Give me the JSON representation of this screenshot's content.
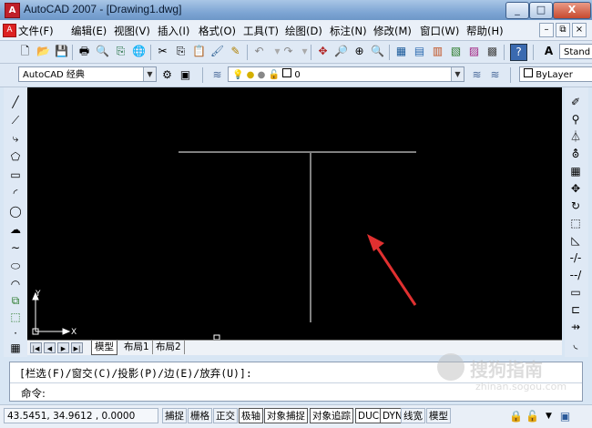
{
  "window": {
    "title": "AutoCAD 2007 - [Drawing1.dwg]",
    "app_icon": "A",
    "minimize": "_",
    "maximize": "□",
    "close": "X"
  },
  "menu": {
    "items": [
      "文件(F)",
      "编辑(E)",
      "视图(V)",
      "插入(I)",
      "格式(O)",
      "工具(T)",
      "绘图(D)",
      "标注(N)",
      "修改(M)",
      "窗口(W)",
      "帮助(H)"
    ],
    "mdi_min": "–",
    "mdi_restore": "⧉",
    "mdi_close": "×"
  },
  "toolbar": {
    "text_style_value": "Stand",
    "workspace_value": "AutoCAD 经典",
    "layer_value": "0",
    "color_value": "ByLayer"
  },
  "canvas": {
    "background": "#000000",
    "line_color": "#ffffff",
    "arrow_color": "#e03030",
    "ucs_x": "X",
    "ucs_y": "Y"
  },
  "layout_tabs": [
    "模型",
    "布局1",
    "布局2"
  ],
  "command": {
    "history": "[栏选(F)/窗交(C)/投影(P)/边(E)/放弃(U)]:",
    "prompt": "命令:"
  },
  "status": {
    "coordinates": "43.5451,  34.9612 , 0.0000",
    "toggles": [
      "捕捉",
      "栅格",
      "正交",
      "极轴",
      "对象捕捉",
      "对象追踪",
      "DUCS",
      "DYN",
      "线宽",
      "模型"
    ]
  },
  "watermark": {
    "text": "搜狗指南",
    "url": "zhinan.sogou.com"
  }
}
